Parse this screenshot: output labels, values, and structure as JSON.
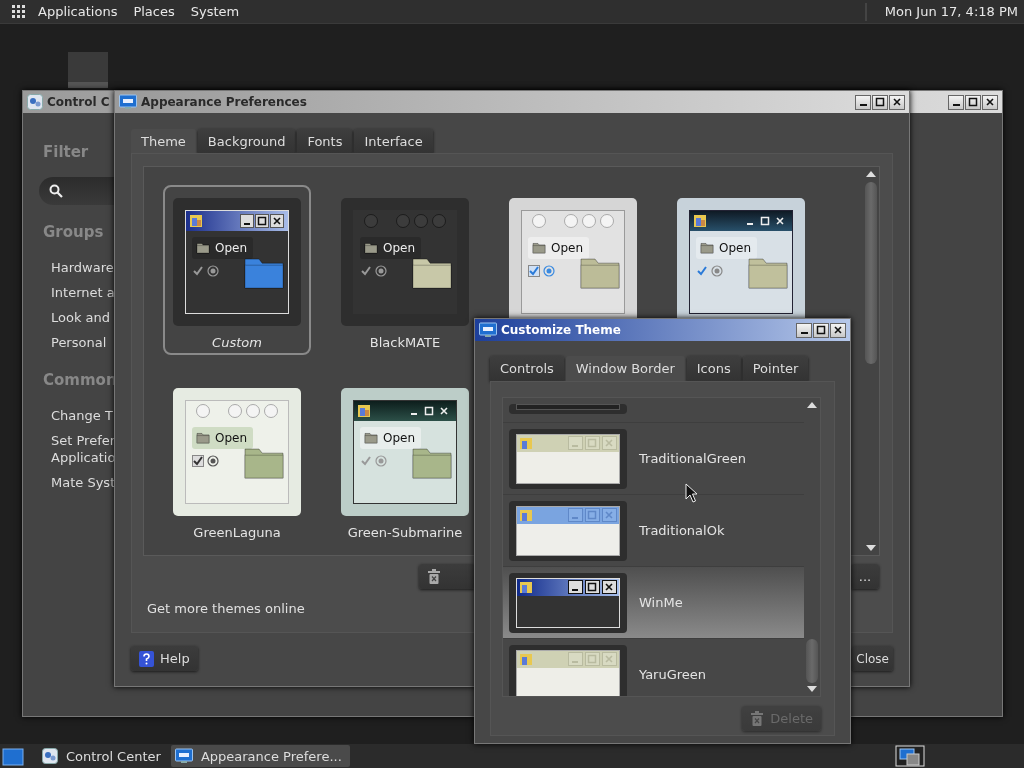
{
  "top_panel": {
    "menus": [
      "Applications",
      "Places",
      "System"
    ],
    "clock": "Mon Jun 17, 4:18 PM"
  },
  "control_center": {
    "title": "Control C",
    "filter_label": "Filter",
    "sections": [
      {
        "heading": "Groups",
        "items": [
          "Hardware",
          "Internet a",
          "Look and",
          "Personal"
        ]
      },
      {
        "heading": "Common",
        "items": [
          "Change T",
          "Set Prefer\nApplicatio",
          "Mate Syst"
        ]
      }
    ]
  },
  "appearance": {
    "title": "Appearance Preferences",
    "tabs": [
      {
        "label": "Theme",
        "selected": true
      },
      {
        "label": "Background",
        "selected": false
      },
      {
        "label": "Fonts",
        "selected": false
      },
      {
        "label": "Interface",
        "selected": false
      }
    ],
    "themes": [
      {
        "name": "Custom",
        "kind": "custom",
        "open_label": "Open",
        "selected": true
      },
      {
        "name": "BlackMATE",
        "kind": "black",
        "open_label": "Open",
        "selected": false
      },
      {
        "kind": "light",
        "open_label": "Open",
        "selected": false
      },
      {
        "kind": "blue",
        "open_label": "Open",
        "selected": false
      },
      {
        "name": "GreenLaguna",
        "kind": "laguna",
        "open_label": "Open",
        "selected": false
      },
      {
        "name": "Green-Submarine",
        "kind": "submarine",
        "open_label": "Open",
        "selected": false
      }
    ],
    "more_button": "...",
    "link": "Get more themes online",
    "help_button": "Help",
    "close_button": "Close"
  },
  "customize": {
    "title": "Customize Theme",
    "tabs": [
      {
        "label": "Controls",
        "selected": false
      },
      {
        "label": "Window Border",
        "selected": true
      },
      {
        "label": "Icons",
        "selected": false
      },
      {
        "label": "Pointer",
        "selected": false
      }
    ],
    "borders": [
      {
        "kind": "dark",
        "selected": false
      },
      {
        "name": "TraditionalGreen",
        "kind": "green",
        "selected": false
      },
      {
        "name": "TraditionalOk",
        "kind": "blue",
        "selected": false
      },
      {
        "name": "WinMe",
        "kind": "winme",
        "selected": true
      },
      {
        "name": "YaruGreen",
        "kind": "green",
        "selected": false
      }
    ],
    "delete_button": {
      "label": "Delete",
      "disabled": true
    }
  },
  "taskbar": {
    "tasks": [
      {
        "label": "Control Center",
        "selected": false
      },
      {
        "label": "Appearance Prefere...",
        "selected": true
      }
    ]
  }
}
